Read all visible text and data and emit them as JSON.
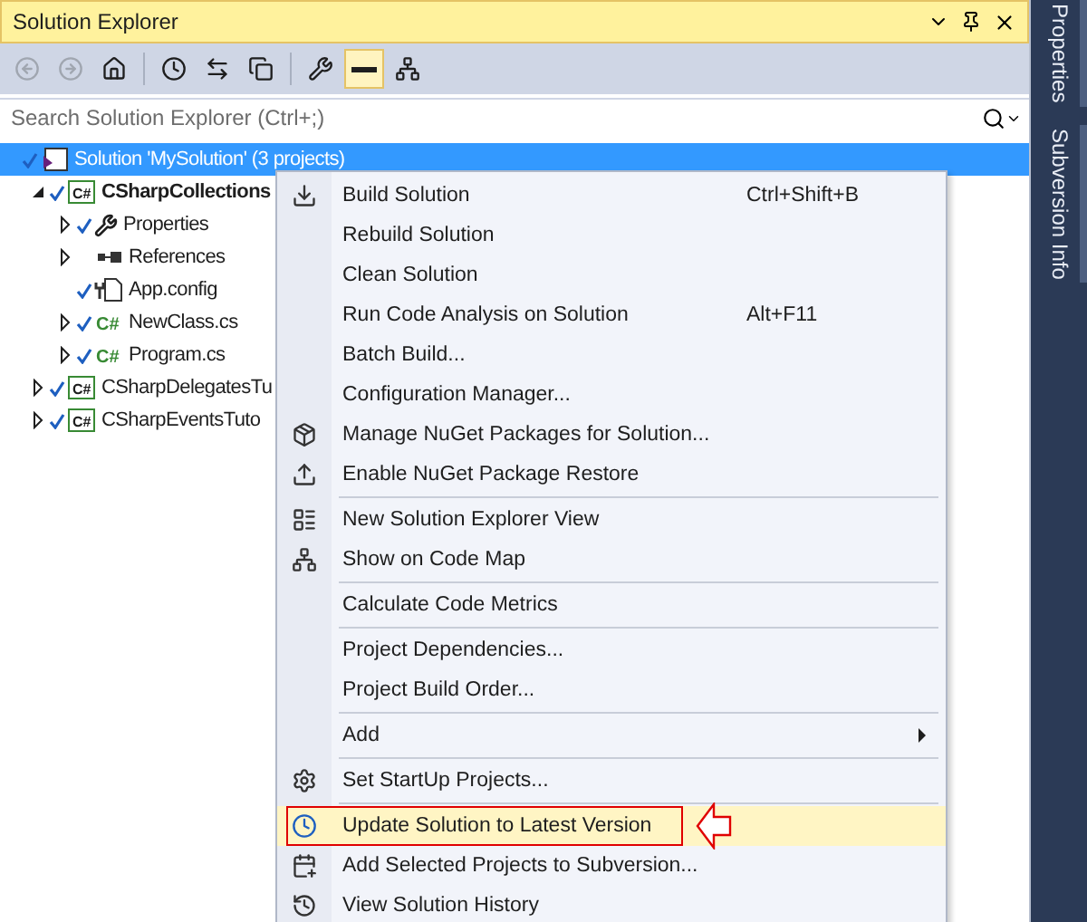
{
  "window": {
    "title": "Solution Explorer"
  },
  "toolbar": [
    {
      "disabled": true,
      "pressed": false
    },
    {
      "disabled": true,
      "pressed": false
    },
    {
      "disabled": false,
      "pressed": false
    },
    {
      "disabled": false,
      "pressed": false
    },
    {
      "disabled": false,
      "pressed": false
    },
    {
      "disabled": false,
      "pressed": false
    },
    {
      "disabled": false,
      "pressed": false
    },
    {
      "disabled": false,
      "pressed": true
    },
    {
      "disabled": false,
      "pressed": false
    }
  ],
  "search": {
    "placeholder": "Search Solution Explorer (Ctrl+;)"
  },
  "tree": [
    {
      "kind": "solution",
      "label": "Solution 'MySolution' (3 projects)",
      "selected": true,
      "bold": false,
      "expandable": false,
      "children": [
        {
          "kind": "project",
          "badge": "C#",
          "label": "CSharpCollections",
          "selected": false,
          "bold": true,
          "expandable": true,
          "expanded": true,
          "children": [
            {
              "kind": "properties",
              "label": "Properties",
              "selected": false,
              "bold": false,
              "expandable": true,
              "expanded": false
            },
            {
              "kind": "references",
              "label": "References",
              "selected": false,
              "bold": false,
              "expandable": true,
              "expanded": false
            },
            {
              "kind": "config",
              "label": "App.config",
              "selected": false,
              "bold": false,
              "expandable": false
            },
            {
              "kind": "csfile",
              "badge": "C#",
              "label": "NewClass.cs",
              "selected": false,
              "bold": false,
              "expandable": true,
              "expanded": false
            },
            {
              "kind": "csfile",
              "badge": "C#",
              "label": "Program.cs",
              "selected": false,
              "bold": false,
              "expandable": true,
              "expanded": false
            }
          ]
        },
        {
          "kind": "project",
          "badge": "C#",
          "label": "CSharpDelegatesTu",
          "selected": false,
          "bold": false,
          "expandable": true,
          "expanded": false
        },
        {
          "kind": "project",
          "badge": "C#",
          "label": "CSharpEventsTuto",
          "selected": false,
          "bold": false,
          "expandable": true,
          "expanded": false
        }
      ]
    }
  ],
  "context_menu": [
    {
      "kind": "item",
      "label": "Build Solution",
      "shortcut": "Ctrl+Shift+B",
      "submenu": false,
      "selected": false,
      "annotated": false
    },
    {
      "kind": "item",
      "label": "Rebuild Solution",
      "submenu": false,
      "selected": false,
      "annotated": false
    },
    {
      "kind": "item",
      "label": "Clean Solution",
      "submenu": false,
      "selected": false,
      "annotated": false
    },
    {
      "kind": "item",
      "label": "Run Code Analysis on Solution",
      "shortcut": "Alt+F11",
      "submenu": false,
      "selected": false,
      "annotated": false
    },
    {
      "kind": "item",
      "label": "Batch Build...",
      "submenu": false,
      "selected": false,
      "annotated": false
    },
    {
      "kind": "item",
      "label": "Configuration Manager...",
      "submenu": false,
      "selected": false,
      "annotated": false
    },
    {
      "kind": "item",
      "label": "Manage NuGet Packages for Solution...",
      "submenu": false,
      "selected": false,
      "annotated": false
    },
    {
      "kind": "item",
      "label": "Enable NuGet Package Restore",
      "submenu": false,
      "selected": false,
      "annotated": false
    },
    {
      "kind": "separator"
    },
    {
      "kind": "item",
      "label": "New Solution Explorer View",
      "submenu": false,
      "selected": false,
      "annotated": false
    },
    {
      "kind": "item",
      "label": "Show on Code Map",
      "submenu": false,
      "selected": false,
      "annotated": false
    },
    {
      "kind": "separator"
    },
    {
      "kind": "item",
      "label": "Calculate Code Metrics",
      "submenu": false,
      "selected": false,
      "annotated": false
    },
    {
      "kind": "separator"
    },
    {
      "kind": "item",
      "label": "Project Dependencies...",
      "submenu": false,
      "selected": false,
      "annotated": false
    },
    {
      "kind": "item",
      "label": "Project Build Order...",
      "submenu": false,
      "selected": false,
      "annotated": false
    },
    {
      "kind": "separator"
    },
    {
      "kind": "item",
      "label": "Add",
      "submenu": true,
      "selected": false,
      "annotated": false
    },
    {
      "kind": "separator"
    },
    {
      "kind": "item",
      "label": "Set StartUp Projects...",
      "submenu": false,
      "selected": false,
      "annotated": false
    },
    {
      "kind": "separator"
    },
    {
      "kind": "item",
      "label": "Update Solution to Latest Version",
      "submenu": false,
      "selected": true,
      "annotated": true
    },
    {
      "kind": "item",
      "label": "Add Selected Projects to Subversion...",
      "submenu": false,
      "selected": false,
      "annotated": false
    },
    {
      "kind": "item",
      "label": "View Solution History",
      "submenu": false,
      "selected": false,
      "annotated": false
    }
  ],
  "side_tabs": [
    "Properties",
    "Subversion Info"
  ]
}
